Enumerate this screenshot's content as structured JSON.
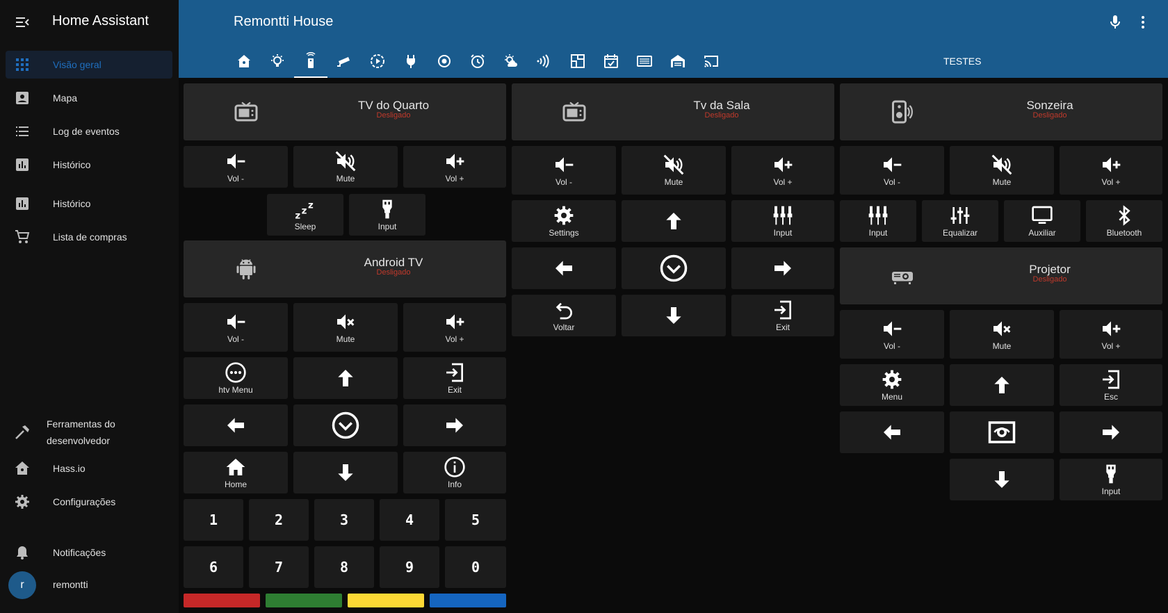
{
  "app": {
    "title": "Home Assistant",
    "page_title": "Remontti House"
  },
  "sidebar": {
    "items": [
      {
        "label": "Visão geral",
        "icon": "grid-icon"
      },
      {
        "label": "Mapa",
        "icon": "account-box-icon"
      },
      {
        "label": "Log de eventos",
        "icon": "list-icon"
      },
      {
        "label": "Histórico",
        "icon": "chart-icon"
      },
      {
        "label": "Histórico",
        "icon": "chart-icon"
      },
      {
        "label": "Lista de compras",
        "icon": "cart-icon"
      }
    ],
    "dev_tools": {
      "line1": "Ferramentas do",
      "line2": "desenvolvedor"
    },
    "hassio": "Hass.io",
    "config": "Configurações",
    "notifications": "Notificações",
    "user": {
      "initial": "r",
      "name": "remontti"
    }
  },
  "tabs": {
    "last_label": "TESTES"
  },
  "cards": {
    "tv_quarto": {
      "name": "TV do Quarto",
      "state": "Desligado"
    },
    "android_tv": {
      "name": "Android TV",
      "state": "Desligado"
    },
    "tv_sala": {
      "name": "Tv da Sala",
      "state": "Desligado"
    },
    "sonzeira": {
      "name": "Sonzeira",
      "state": "Desligado"
    },
    "projetor": {
      "name": "Projetor",
      "state": "Desligado"
    }
  },
  "labels": {
    "vol_minus": "Vol -",
    "mute": "Mute",
    "vol_plus": "Vol +",
    "sleep": "Sleep",
    "input": "Input",
    "htv_menu": "htv Menu",
    "exit": "Exit",
    "home": "Home",
    "info": "Info",
    "settings": "Settings",
    "voltar": "Voltar",
    "equalizar": "Equalizar",
    "auxiliar": "Auxiliar",
    "bluetooth": "Bluetooth",
    "menu": "Menu",
    "esc": "Esc"
  },
  "numbers": [
    "1",
    "2",
    "3",
    "4",
    "5",
    "6",
    "7",
    "8",
    "9",
    "0"
  ],
  "colors": {
    "accent": "#1a5b8d",
    "off_state": "#c0392b",
    "red": "#c62828",
    "green": "#2e7d32",
    "yellow": "#fdd835",
    "blue": "#1565c0"
  }
}
